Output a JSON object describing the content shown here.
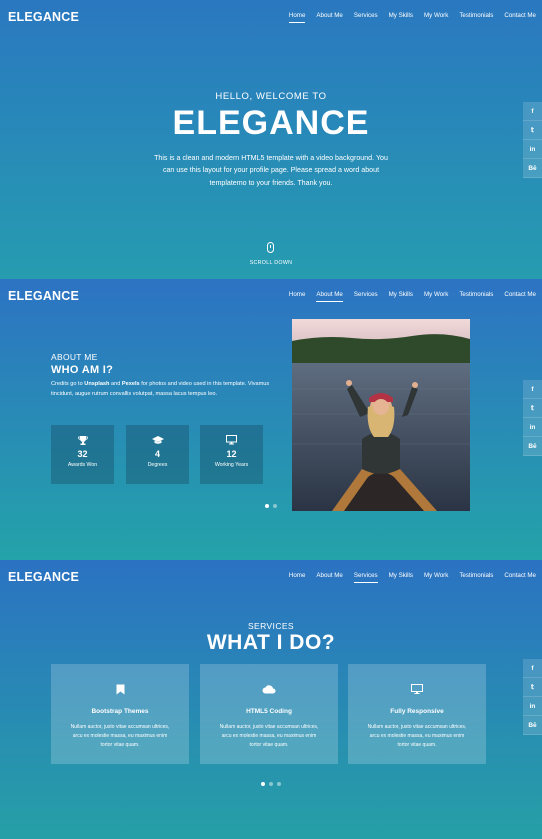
{
  "brand": "ELEGANCE",
  "nav": {
    "items": [
      "Home",
      "About Me",
      "Services",
      "My Skills",
      "My Work",
      "Testimonials",
      "Contact Me"
    ]
  },
  "social": [
    {
      "glyph": "f",
      "icon": "facebook-icon"
    },
    {
      "glyph": "𝕥",
      "icon": "twitter-icon"
    },
    {
      "glyph": "in",
      "icon": "linkedin-icon"
    },
    {
      "glyph": "Bē",
      "icon": "behance-icon"
    }
  ],
  "hero": {
    "subtitle": "HELLO, WELCOME TO",
    "title": "ELEGANCE",
    "description": "This is a clean and modern HTML5 template with a video background. You can use this layout for your profile page. Please spread a word about templatemo to your friends. Thank you.",
    "scroll_label": "SCROLL DOWN"
  },
  "about": {
    "label": "ABOUT ME",
    "title": "WHO AM I?",
    "text_prefix": "Credits go to ",
    "link1": "Unsplash",
    "text_and": " and ",
    "link2": "Pexels",
    "text_suffix": " for photos and video used in this template. Vivamus tincidunt, augue rutrum convallis volutpat, massa lacus tempus leo.",
    "stats": [
      {
        "icon": "trophy-icon",
        "value": "32",
        "label": "Awards Won"
      },
      {
        "icon": "graduation-cap-icon",
        "value": "4",
        "label": "Degrees"
      },
      {
        "icon": "desktop-icon",
        "value": "12",
        "label": "Working Years"
      }
    ]
  },
  "services": {
    "label": "SERVICES",
    "title": "WHAT I DO?",
    "cards": [
      {
        "icon": "bookmark-icon",
        "title": "Bootstrap Themes",
        "text": "Nullam auctor, justo vitae accumsan ultrices, arcu ex molestie massa, eu maximus enim tortor vitae quam."
      },
      {
        "icon": "cloud-icon",
        "title": "HTML5 Coding",
        "text": "Nullam auctor, justo vitae accumsan ultrices, arcu ex molestie massa, eu maximus enim tortor vitae quam."
      },
      {
        "icon": "desktop-icon",
        "title": "Fully Responsive",
        "text": "Nullam auctor, justo vitae accumsan ultrices, arcu ex molestie massa, eu maximus enim tortor vitae quam."
      }
    ]
  }
}
